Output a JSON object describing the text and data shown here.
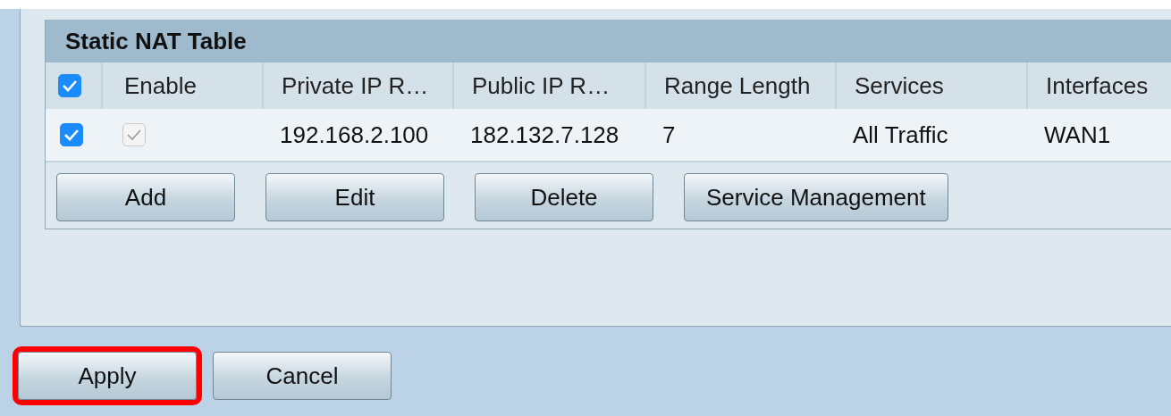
{
  "nat_table": {
    "title": "Static NAT Table",
    "columns": [
      {
        "kind": "checkbox",
        "checked": true
      },
      {
        "kind": "text",
        "label": "Enable"
      },
      {
        "kind": "text",
        "label": "Private IP R…"
      },
      {
        "kind": "text",
        "label": "Public IP R…"
      },
      {
        "kind": "text",
        "label": "Range Length"
      },
      {
        "kind": "text",
        "label": "Services"
      },
      {
        "kind": "text",
        "label": "Interfaces"
      }
    ],
    "rows": [
      {
        "cells": [
          {
            "kind": "checkbox",
            "checked": true,
            "disabled": false
          },
          {
            "kind": "checkbox",
            "checked": true,
            "disabled": true
          },
          {
            "kind": "text",
            "text": "192.168.2.100"
          },
          {
            "kind": "text",
            "text": "182.132.7.128"
          },
          {
            "kind": "text",
            "text": "7"
          },
          {
            "kind": "text",
            "text": "All Traffic"
          },
          {
            "kind": "text",
            "text": "WAN1"
          }
        ]
      }
    ],
    "buttons": [
      "Add",
      "Edit",
      "Delete",
      "Service Management"
    ]
  },
  "footer_buttons": [
    {
      "label": "Apply",
      "highlighted": true
    },
    {
      "label": "Cancel",
      "highlighted": false
    }
  ]
}
